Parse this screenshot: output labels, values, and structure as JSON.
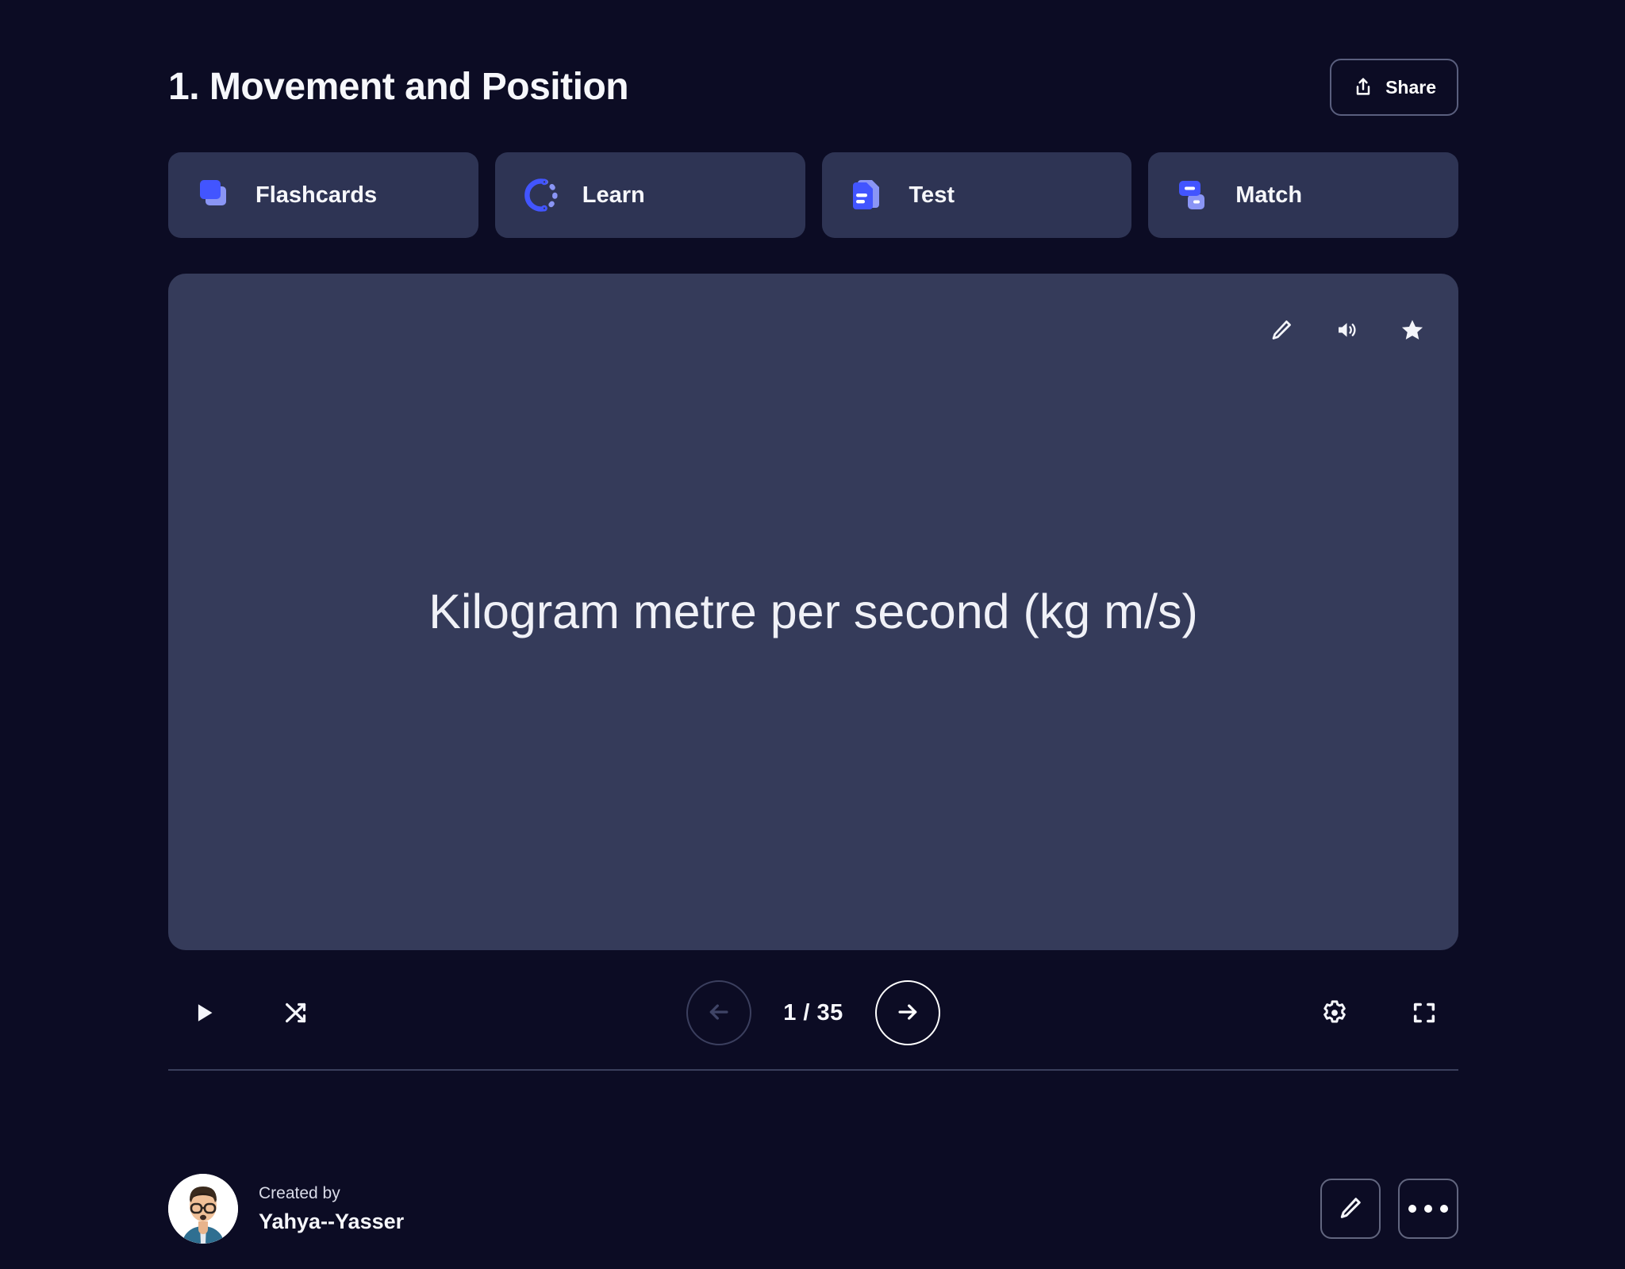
{
  "header": {
    "title": "1. Movement and Position",
    "share_label": "Share",
    "share_icon": "share-upload-icon"
  },
  "mode_tabs": [
    {
      "label": "Flashcards",
      "icon": "stacked-cards-icon",
      "active": true
    },
    {
      "label": "Learn",
      "icon": "progress-circle-icon",
      "active": false
    },
    {
      "label": "Test",
      "icon": "document-lines-icon",
      "active": false
    },
    {
      "label": "Match",
      "icon": "two-tiles-icon",
      "active": false
    }
  ],
  "flashcard": {
    "term": "Kilogram metre per second (kg m/s)",
    "actions": [
      {
        "name": "edit-card",
        "icon": "pencil-icon"
      },
      {
        "name": "play-audio",
        "icon": "speaker-icon"
      },
      {
        "name": "star-card",
        "icon": "star-icon"
      }
    ]
  },
  "controls": {
    "play_icon": "play-icon",
    "shuffle_icon": "shuffle-icon",
    "prev_icon": "arrow-left-icon",
    "next_icon": "arrow-right-icon",
    "counter": "1 / 35",
    "current_index": 1,
    "total_cards": 35,
    "prev_enabled": false,
    "next_enabled": true,
    "settings_icon": "gear-icon",
    "fullscreen_icon": "fullscreen-icon"
  },
  "footer": {
    "created_by_label": "Created by",
    "author_name": "Yahya--Yasser",
    "avatar_icon": "user-avatar",
    "edit_icon": "pencil-icon",
    "more_icon": "ellipsis-icon"
  },
  "colors": {
    "page_background": "#0c0c24",
    "card_surface": "#353b5a",
    "tab_surface": "#2e3454",
    "accent_blue": "#4255ff",
    "accent_blue_light": "#8a95f5",
    "text_primary": "#f6f7fb",
    "divider": "#3a3f5c",
    "disabled_arrow": "#3b3f5e"
  }
}
